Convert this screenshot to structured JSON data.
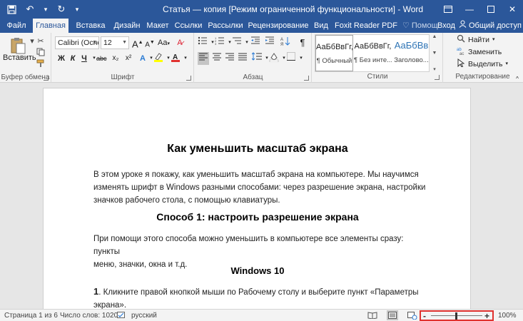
{
  "window": {
    "title": "Статья — копия [Режим ограниченной функциональности] - Word"
  },
  "tabs": [
    {
      "label": "Файл",
      "active": false
    },
    {
      "label": "Главная",
      "active": true
    },
    {
      "label": "Вставка",
      "active": false
    },
    {
      "label": "Дизайн",
      "active": false
    },
    {
      "label": "Макет",
      "active": false
    },
    {
      "label": "Ссылки",
      "active": false
    },
    {
      "label": "Рассылки",
      "active": false
    },
    {
      "label": "Рецензирование",
      "active": false
    },
    {
      "label": "Вид",
      "active": false
    },
    {
      "label": "Foxit Reader PDF",
      "active": false
    }
  ],
  "tell_me": "Помощ",
  "signin": "Вход",
  "share": "Общий доступ",
  "ribbon": {
    "clipboard": {
      "paste_label": "Вставить",
      "group_label": "Буфер обмена"
    },
    "font": {
      "font_name": "Calibri (Осно",
      "font_size": "12",
      "grow": "A",
      "shrink": "A",
      "case": "Aa",
      "bold": "Ж",
      "italic": "К",
      "underline": "Ч",
      "strike": "abc",
      "sub": "x₂",
      "sup": "x²",
      "group_label": "Шрифт"
    },
    "paragraph": {
      "group_label": "Абзац",
      "pilcrow": "¶"
    },
    "styles": {
      "items": [
        {
          "preview": "АаБбВвГг,",
          "name": "¶ Обычный",
          "selected": true
        },
        {
          "preview": "АаБбВвГг,",
          "name": "¶ Без инте...",
          "selected": false
        },
        {
          "preview": "АаБбВв",
          "name": "Заголово...",
          "selected": false
        }
      ],
      "group_label": "Стили"
    },
    "editing": {
      "find": "Найти",
      "replace": "Заменить",
      "select": "Выделить",
      "group_label": "Редактирование"
    }
  },
  "document": {
    "title": "Как уменьшить масштаб экрана",
    "p1_lines": [
      "В этом уроке я покажу, как уменьшить масштаб экрана на компьютере. Мы научимся",
      "изменять шрифт в Windows разными способами: через разрешение экрана, настройки",
      "значков рабочего стола, с помощью клавиатуры."
    ],
    "h2": "Способ 1: настроить разрешение экрана",
    "p2_lines": [
      "При помощи этого способа можно уменьшить в компьютере все элементы сразу: пункты",
      "меню, значки, окна и т.д."
    ],
    "h3": "Windows 10",
    "step_num": "1",
    "step_lines": [
      ". Кликните правой кнопкой мыши по Рабочему столу и выберите пункт «Параметры",
      "экрана»."
    ]
  },
  "status": {
    "page": "Страница 1 из 6",
    "words": "Число слов: 1020",
    "lang": "русский",
    "zoom": "100%",
    "zoom_minus": "-",
    "zoom_plus": "+"
  },
  "colors": {
    "accent": "#2b579a",
    "highlight": "#e0322f"
  }
}
